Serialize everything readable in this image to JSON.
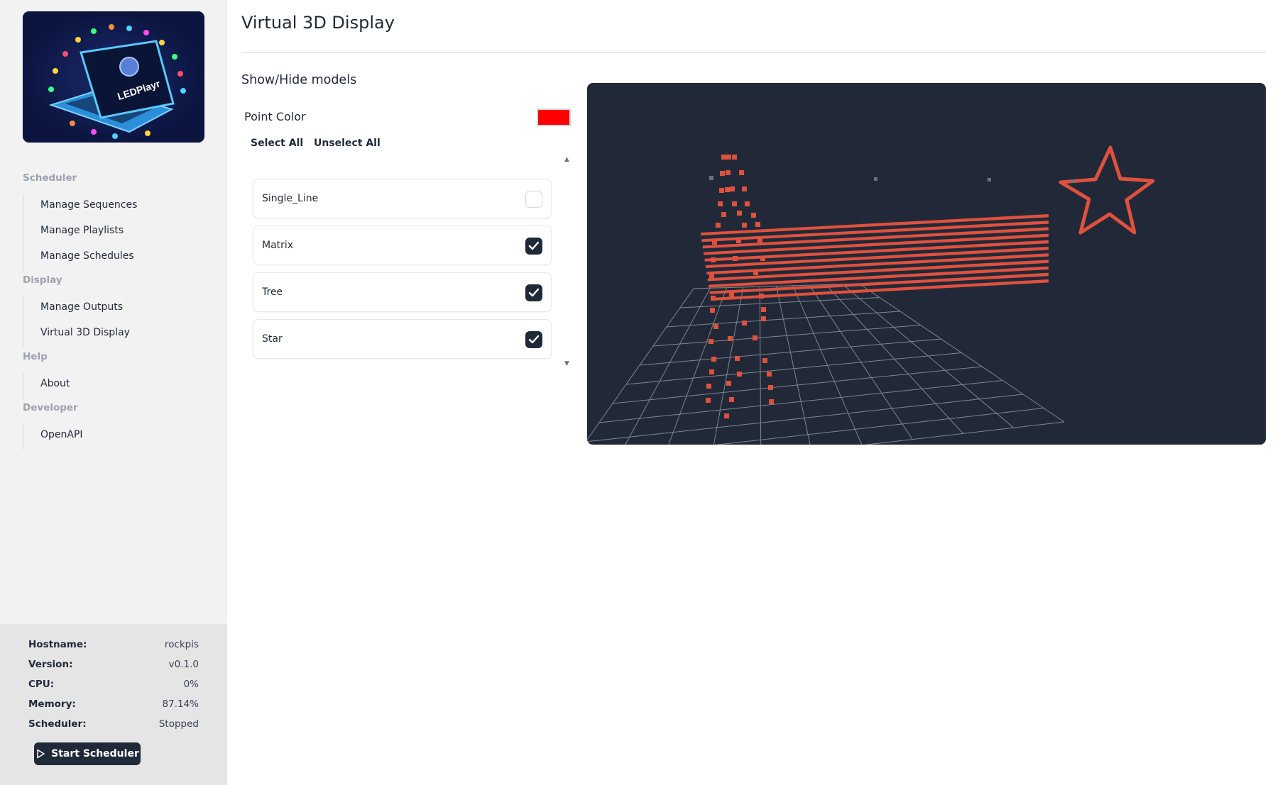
{
  "sidebar": {
    "logo": {
      "text": "LEDPlayr"
    },
    "sections": [
      {
        "title": "Scheduler",
        "items": [
          "Manage Sequences",
          "Manage Playlists",
          "Manage Schedules"
        ]
      },
      {
        "title": "Display",
        "items": [
          "Manage Outputs",
          "Virtual 3D Display"
        ]
      },
      {
        "title": "Help",
        "items": [
          "About"
        ]
      },
      {
        "title": "Developer",
        "items": [
          "OpenAPI"
        ]
      }
    ]
  },
  "system": {
    "hostname_label": "Hostname:",
    "hostname": "rockpis",
    "version_label": "Version:",
    "version": "v0.1.0",
    "cpu_label": "CPU:",
    "cpu": "0%",
    "memory_label": "Memory:",
    "memory": "87.14%",
    "scheduler_label": "Scheduler:",
    "scheduler": "Stopped",
    "start_button": "Start Scheduler"
  },
  "main": {
    "title": "Virtual 3D Display",
    "section_title": "Show/Hide models",
    "point_color_label": "Point Color",
    "point_color": "#ff0000",
    "select_all": "Select All",
    "unselect_all": "Unselect All",
    "models": [
      {
        "name": "Single_Line",
        "checked": false
      },
      {
        "name": "Matrix",
        "checked": true
      },
      {
        "name": "Tree",
        "checked": true
      },
      {
        "name": "Star",
        "checked": true
      }
    ]
  },
  "colors": {
    "viewer_bg": "#212938",
    "led": "#e0513d",
    "grid": "#8a9099",
    "accent_dark": "#1f2937"
  }
}
